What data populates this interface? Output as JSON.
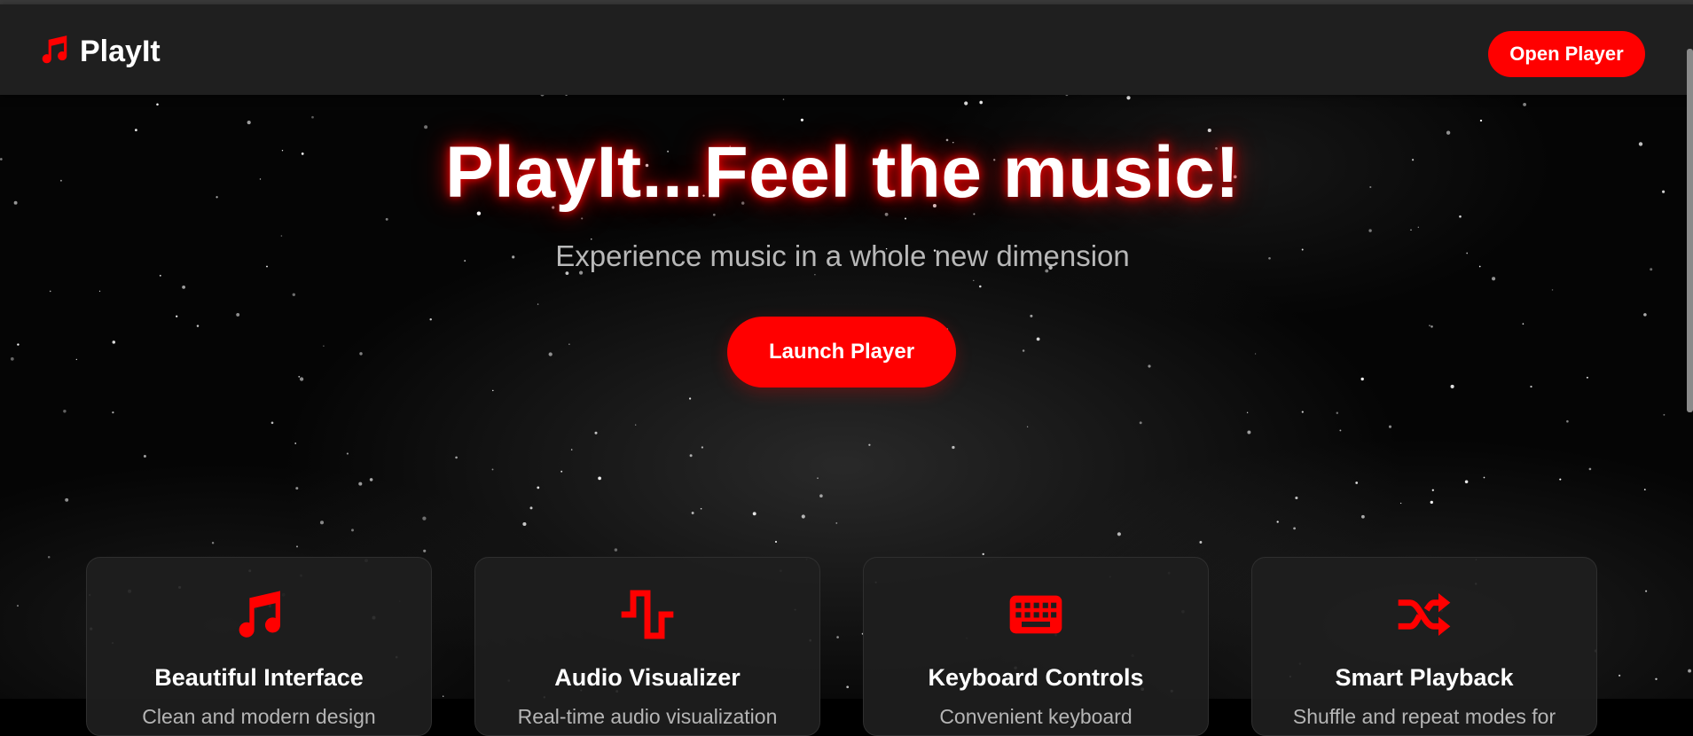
{
  "brand": {
    "name": "PlayIt",
    "icon": "music-note-icon"
  },
  "nav": {
    "open_player_label": "Open Player"
  },
  "hero": {
    "title": "PlayIt...Feel the music!",
    "subtitle": "Experience music in a whole new dimension",
    "cta_label": "Launch Player"
  },
  "features": [
    {
      "icon": "music-note-icon",
      "title": "Beautiful Interface",
      "description": "Clean and modern design"
    },
    {
      "icon": "waveform-icon",
      "title": "Audio Visualizer",
      "description": "Real-time audio visualization"
    },
    {
      "icon": "keyboard-icon",
      "title": "Keyboard Controls",
      "description": "Convenient keyboard"
    },
    {
      "icon": "shuffle-icon",
      "title": "Smart Playback",
      "description": "Shuffle and repeat modes for"
    }
  ],
  "colors": {
    "accent": "#ff0000",
    "navbar": "#1f1f1f",
    "background": "#050505",
    "card": "#1e1e1e"
  }
}
